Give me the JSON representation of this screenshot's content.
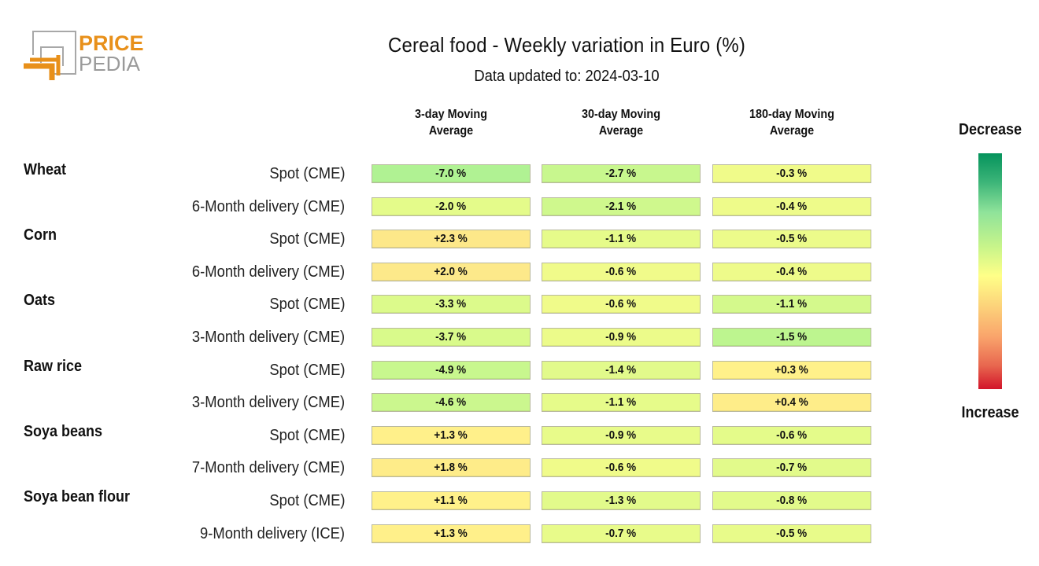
{
  "brand": {
    "logo_top": "PRICE",
    "logo_bottom": "PEDIA",
    "orange": "#e8901a",
    "gray": "#a0a0a0"
  },
  "header": {
    "title": "Cereal food - Weekly variation in Euro (%)",
    "subtitle": "Data updated to: 2024-03-10"
  },
  "legend": {
    "top_label": "Decrease",
    "bottom_label": "Increase"
  },
  "chart_data": {
    "type": "heatmap",
    "title": "Cereal food - Weekly variation in Euro (%)",
    "subtitle": "Data updated to: 2024-03-10",
    "unit": "%",
    "columns": [
      "3-day Moving Average",
      "30-day Moving Average",
      "180-day Moving Average"
    ],
    "column_lines": [
      [
        "3-day Moving",
        "Average"
      ],
      [
        "30-day Moving",
        "Average"
      ],
      [
        "180-day Moving",
        "Average"
      ]
    ],
    "color_scale": {
      "low_label": "Decrease",
      "high_label": "Increase",
      "low_color": "#05935c",
      "mid_color": "#ffff88",
      "high_color": "#d2142a"
    },
    "rows": [
      {
        "group": "Wheat",
        "label": "Spot (CME)",
        "values": [
          -7.0,
          -2.7,
          -0.3
        ],
        "display": [
          "-7.0 %",
          "-2.7 %",
          "-0.3 %"
        ],
        "colors": [
          "#b0f293",
          "#c8f78e",
          "#f0fb8a"
        ]
      },
      {
        "group": "",
        "label": "6-Month delivery (CME)",
        "values": [
          -2.0,
          -2.1,
          -0.4
        ],
        "display": [
          "-2.0 %",
          "-2.1 %",
          "-0.4 %"
        ],
        "colors": [
          "#e4fb8a",
          "#cff88d",
          "#eefb8a"
        ]
      },
      {
        "group": "Corn",
        "label": "Spot (CME)",
        "values": [
          2.3,
          -1.1,
          -0.5
        ],
        "display": [
          "+2.3 %",
          "-1.1 %",
          "-0.5 %"
        ],
        "colors": [
          "#fde889",
          "#e6fb8a",
          "#ecfb8a"
        ]
      },
      {
        "group": "",
        "label": "6-Month delivery (CME)",
        "values": [
          2.0,
          -0.6,
          -0.4
        ],
        "display": [
          "+2.0 %",
          "-0.6 %",
          "-0.4 %"
        ],
        "colors": [
          "#fde98a",
          "#f0fb8a",
          "#eefb8a"
        ]
      },
      {
        "group": "Oats",
        "label": "Spot (CME)",
        "values": [
          -3.3,
          -0.6,
          -1.1
        ],
        "display": [
          "-3.3 %",
          "-0.6 %",
          "-1.1 %"
        ],
        "colors": [
          "#dcfa8b",
          "#f0fb8a",
          "#d4f98c"
        ]
      },
      {
        "group": "",
        "label": "3-Month delivery (CME)",
        "values": [
          -3.7,
          -0.9,
          -1.5
        ],
        "display": [
          "-3.7 %",
          "-0.9 %",
          "-1.5 %"
        ],
        "colors": [
          "#d9fa8b",
          "#ecfb8a",
          "#bdf58f"
        ]
      },
      {
        "group": "Raw rice",
        "label": "Spot (CME)",
        "values": [
          -4.9,
          -1.4,
          0.3
        ],
        "display": [
          "-4.9 %",
          "-1.4 %",
          "+0.3 %"
        ],
        "colors": [
          "#c8f78e",
          "#e2fa8b",
          "#fff18a"
        ]
      },
      {
        "group": "",
        "label": "3-Month delivery (CME)",
        "values": [
          -4.6,
          -1.1,
          0.4
        ],
        "display": [
          "-4.6 %",
          "-1.1 %",
          "+0.4 %"
        ],
        "colors": [
          "#cbf78e",
          "#e6fb8a",
          "#feed89"
        ]
      },
      {
        "group": "Soya beans",
        "label": "Spot (CME)",
        "values": [
          1.3,
          -0.9,
          -0.6
        ],
        "display": [
          "+1.3 %",
          "-0.9 %",
          "-0.6 %"
        ],
        "colors": [
          "#fff08a",
          "#e8fb8a",
          "#e4fb8a"
        ]
      },
      {
        "group": "",
        "label": "7-Month delivery (CME)",
        "values": [
          1.8,
          -0.6,
          -0.7
        ],
        "display": [
          "+1.8 %",
          "-0.6 %",
          "-0.7 %"
        ],
        "colors": [
          "#feec89",
          "#f0fb8a",
          "#e2fa8b"
        ]
      },
      {
        "group": "Soya bean flour",
        "label": "Spot (CME)",
        "values": [
          1.1,
          -1.3,
          -0.8
        ],
        "display": [
          "+1.1 %",
          "-1.3 %",
          "-0.8 %"
        ],
        "colors": [
          "#fff18a",
          "#e2fa8b",
          "#e2fa8b"
        ]
      },
      {
        "group": "",
        "label": "9-Month delivery (ICE)",
        "values": [
          1.3,
          -0.7,
          -0.5
        ],
        "display": [
          "+1.3 %",
          "-0.7 %",
          "-0.5 %"
        ],
        "colors": [
          "#fff08a",
          "#e8fb8a",
          "#e8fb8a"
        ]
      }
    ]
  }
}
